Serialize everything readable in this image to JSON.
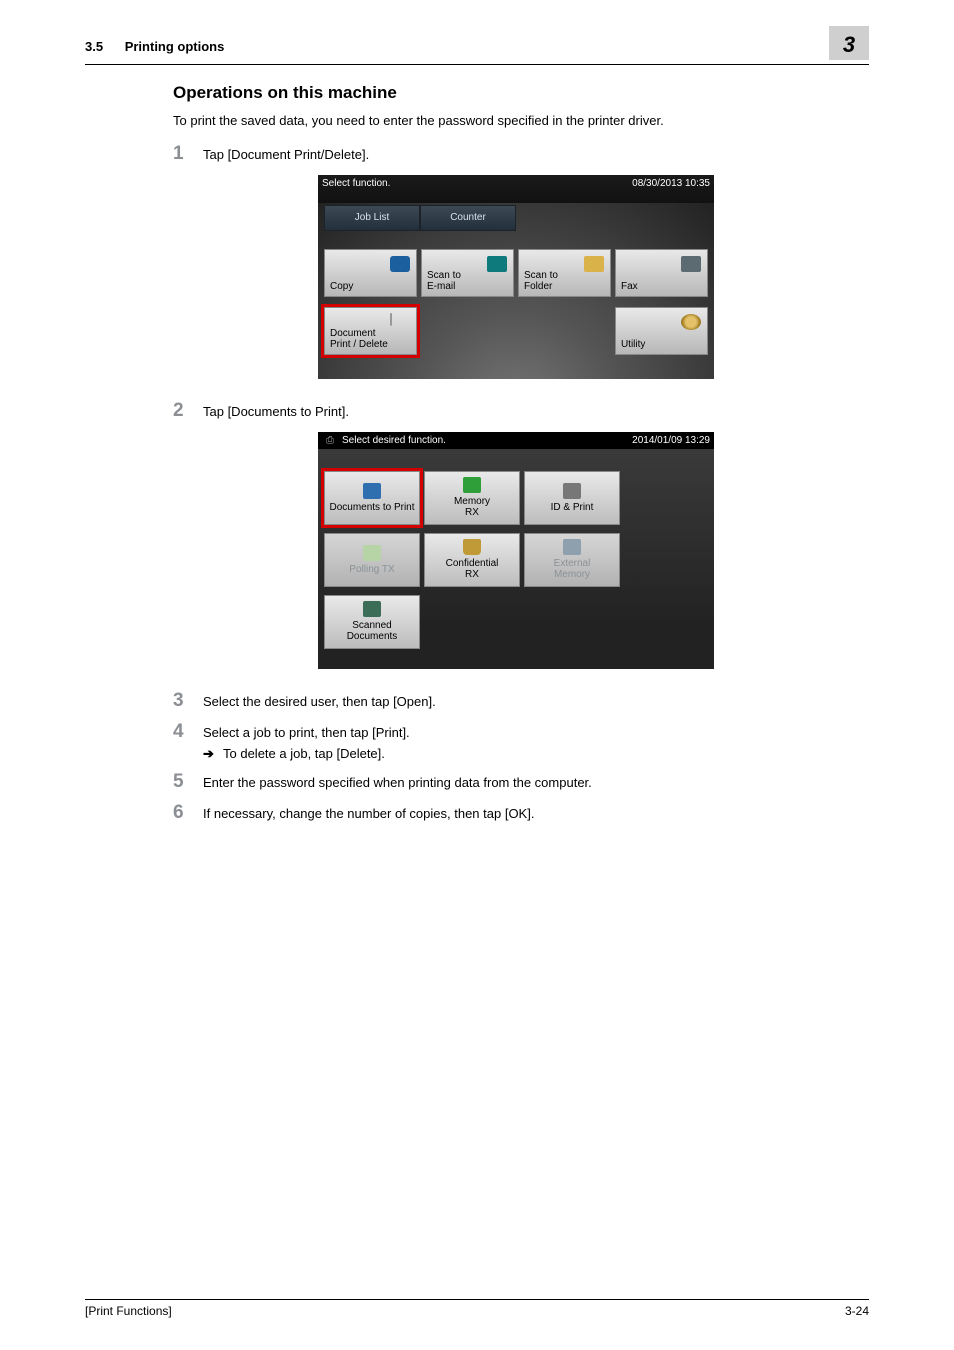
{
  "header": {
    "section_number": "3.5",
    "section_title": "Printing options",
    "chapter_number": "3"
  },
  "body": {
    "heading": "Operations on this machine",
    "intro": "To print the saved data, you need to enter the password specified in the printer driver.",
    "steps": {
      "s1": "Tap [Document Print/Delete].",
      "s2": "Tap [Documents to Print].",
      "s3": "Select the desired user, then tap [Open].",
      "s4": "Select a job to print, then tap [Print].",
      "s4_sub": "To delete a job, tap [Delete].",
      "s5": "Enter the password specified when printing data from the computer.",
      "s6": "If necessary, change the number of copies, then tap [OK]."
    }
  },
  "screenshot1": {
    "title": "Select function.",
    "timestamp": "08/30/2013 10:35",
    "tabs": {
      "joblist": "Job List",
      "counter": "Counter"
    },
    "tiles": {
      "copy": "Copy",
      "scan_email": "Scan to\nE-mail",
      "scan_folder": "Scan to\nFolder",
      "fax": "Fax",
      "doc_pd": "Document\nPrint / Delete",
      "utility": "Utility"
    }
  },
  "screenshot2": {
    "title": "Select desired function.",
    "timestamp": "2014/01/09 13:29",
    "tiles": {
      "docs_to_print": "Documents to Print",
      "memory_rx": "Memory\nRX",
      "id_print": "ID & Print",
      "polling_tx": "Polling TX",
      "confidential_rx": "Confidential\nRX",
      "external_memory": "External\nMemory",
      "scanned_docs": "Scanned\nDocuments"
    }
  },
  "footer": {
    "left": "[Print Functions]",
    "right": "3-24"
  }
}
